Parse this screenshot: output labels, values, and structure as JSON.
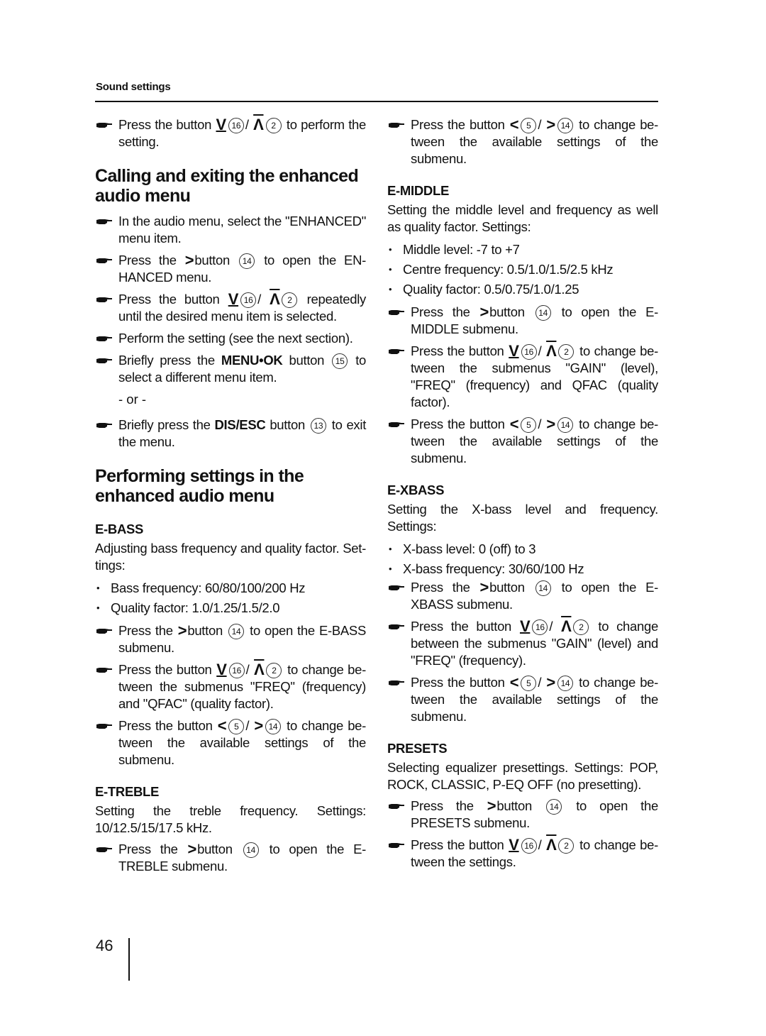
{
  "header": {
    "title": "Sound settings"
  },
  "page_number": "46",
  "buttons": {
    "b16": "16",
    "b2": "2",
    "b14": "14",
    "b5": "5",
    "b15": "15",
    "b13": "13"
  },
  "left": {
    "intro_step": {
      "a": "Press the button",
      "b": "/",
      "c": "to perform the setting."
    },
    "calling": {
      "title": "Calling and exiting the enhanced audio menu",
      "s1": "In the audio menu, select the \"ENHANCED\" menu item.",
      "s2": {
        "a": "Press the",
        "b": "button",
        "c": "to open the EN-HANCED menu."
      },
      "s3": {
        "a": "Press the button",
        "b": "/",
        "c": "repeatedly until the desired menu item is selected."
      },
      "s4": "Perform the setting (see the next section).",
      "s5": {
        "a": "Briefly press the",
        "bold": "MENU•OK",
        "b": "button",
        "c": "to select a different menu item."
      },
      "or": "- or -",
      "s6": {
        "a": "Briefly press the",
        "bold": "DIS/ESC",
        "b": "button",
        "c": "to exit the menu."
      }
    },
    "performing": {
      "title": "Performing settings in the enhanced audio menu"
    },
    "ebass": {
      "title": "E-BASS",
      "desc": "Adjusting bass frequency and quality factor. Set-tings:",
      "bullets": [
        "Bass frequency: 60/80/100/200 Hz",
        "Quality factor: 1.0/1.25/1.5/2.0"
      ],
      "s1": {
        "a": "Press the",
        "b": "button",
        "c": "to open the E-BASS submenu."
      },
      "s2": {
        "a": "Press the button",
        "b": "/",
        "c": "to change be-tween the submenus \"FREQ\" (frequency) and \"QFAC\" (quality factor)."
      },
      "s3": {
        "a": "Press the button",
        "b": "/",
        "c": "to change be-tween the available settings of the submenu."
      }
    },
    "etreble": {
      "title": "E-TREBLE",
      "desc": "Setting the treble frequency. Settings: 10/12.5/15/17.5 kHz.",
      "s1": {
        "a": "Press the",
        "b": "button",
        "c": "to open the E-TREBLE submenu."
      }
    }
  },
  "right": {
    "treble_step2": {
      "a": "Press the button",
      "b": "/",
      "c": "to change be-tween the available settings of the submenu."
    },
    "emiddle": {
      "title": "E-MIDDLE",
      "desc": "Setting the middle level and frequency as well as quality factor. Settings:",
      "bullets": [
        "Middle level: -7 to +7",
        "Centre frequency: 0.5/1.0/1.5/2.5 kHz",
        "Quality factor: 0.5/0.75/1.0/1.25"
      ],
      "s1": {
        "a": "Press the",
        "b": "button",
        "c": "to open the E-MIDDLE submenu."
      },
      "s2": {
        "a": "Press the button",
        "b": "/",
        "c": "to change be-tween the submenus \"GAIN\" (level), \"FREQ\" (frequency) and QFAC (quality factor)."
      },
      "s3": {
        "a": "Press the button",
        "b": "/",
        "c": "to change be-tween the available settings of the submenu."
      }
    },
    "exbass": {
      "title": "E-XBASS",
      "desc": "Setting the X-bass level and frequency. Settings:",
      "bullets": [
        "X-bass level: 0 (off) to 3",
        "X-bass frequency: 30/60/100 Hz"
      ],
      "s1": {
        "a": "Press the",
        "b": "button",
        "c": "to open the E-XBASS submenu."
      },
      "s2": {
        "a": "Press the button",
        "b": "/",
        "c": "to change between the submenus \"GAIN\" (level) and \"FREQ\" (frequency)."
      },
      "s3": {
        "a": "Press the button",
        "b": "/",
        "c": "to change be-tween the available settings of the submenu."
      }
    },
    "presets": {
      "title": "PRESETS",
      "desc": "Selecting equalizer presettings. Settings: POP, ROCK, CLASSIC, P-EQ OFF (no presetting).",
      "s1": {
        "a": "Press the",
        "b": "button",
        "c": "to open the PRESETS submenu."
      },
      "s2": {
        "a": "Press the button",
        "b": "/",
        "c": "to change be-tween the settings."
      }
    }
  }
}
